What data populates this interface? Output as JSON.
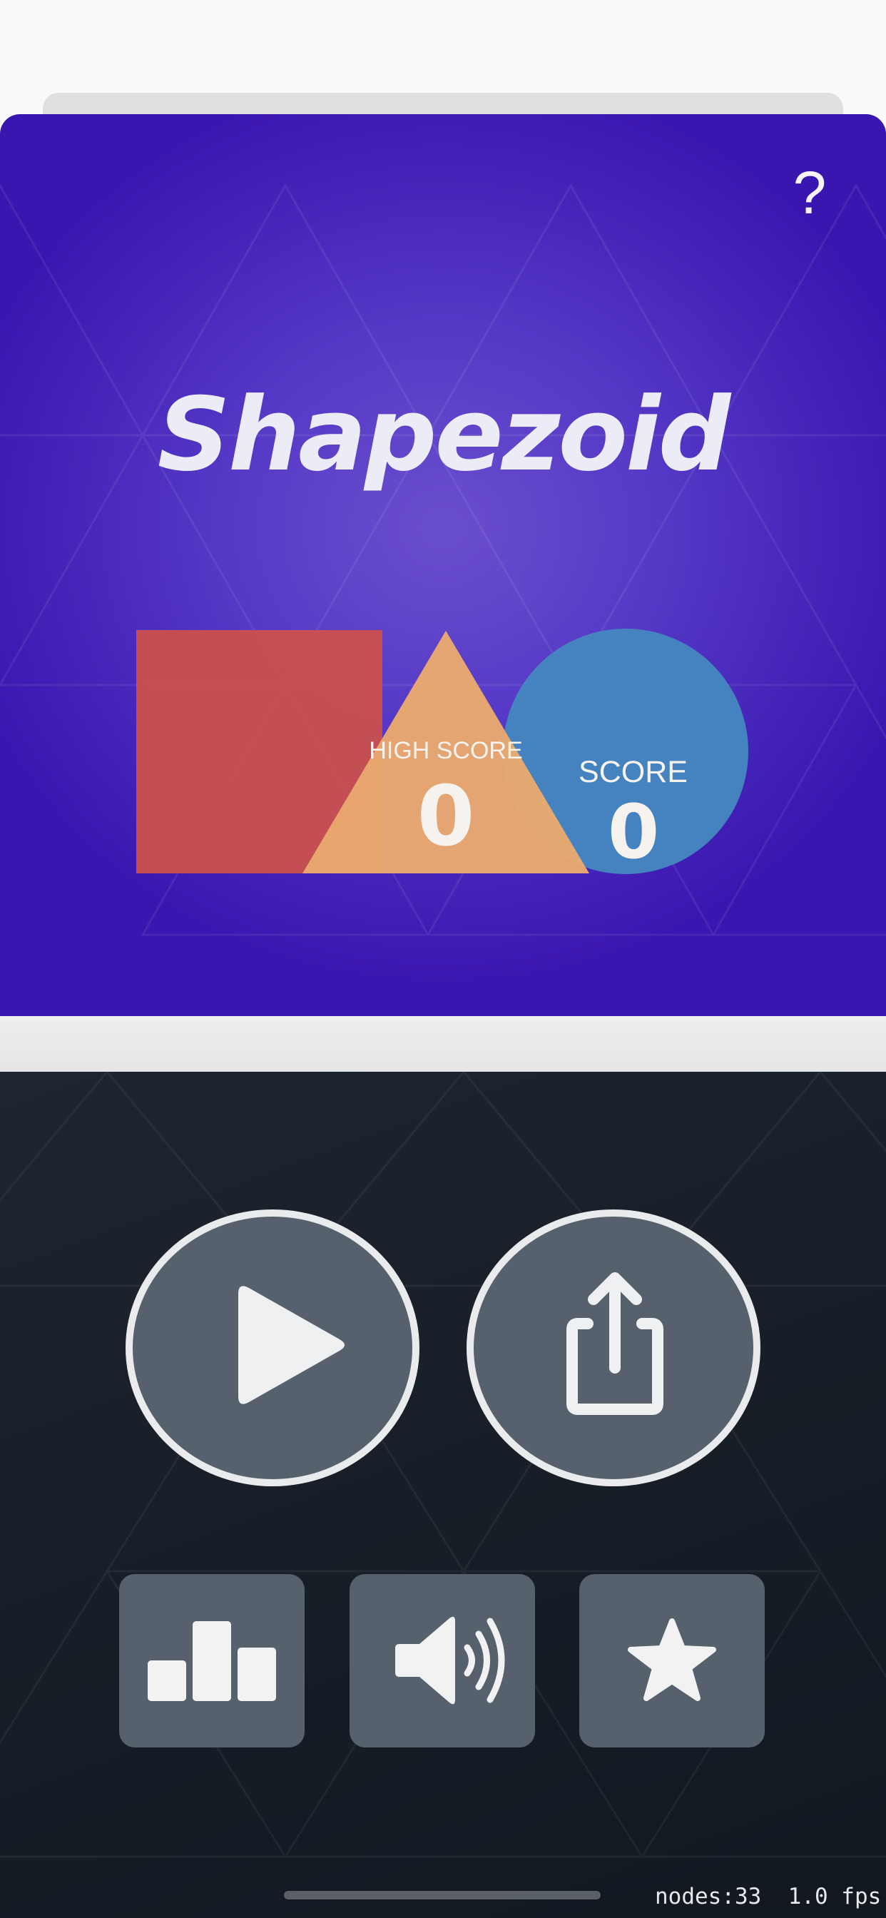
{
  "game": {
    "title": "Shapezoid",
    "help_label": "?",
    "high_score_label": "HIGH SCORE",
    "high_score_value": "0",
    "score_label": "SCORE",
    "score_value": "0"
  },
  "controls": {
    "play": "play-icon",
    "share": "share-icon",
    "leaderboard": "leaderboard-icon",
    "sound": "speaker-icon",
    "rate": "star-icon"
  },
  "debug": {
    "nodes": "nodes:33",
    "fps": "1.0 fps"
  },
  "colors": {
    "hero_background": "#5538c6",
    "square": "#c75151",
    "triangle": "#e9a96f",
    "circle": "#4486c0",
    "bottom_background": "#171e27",
    "button_fill": "#56616d",
    "button_border": "#e9ebed"
  }
}
